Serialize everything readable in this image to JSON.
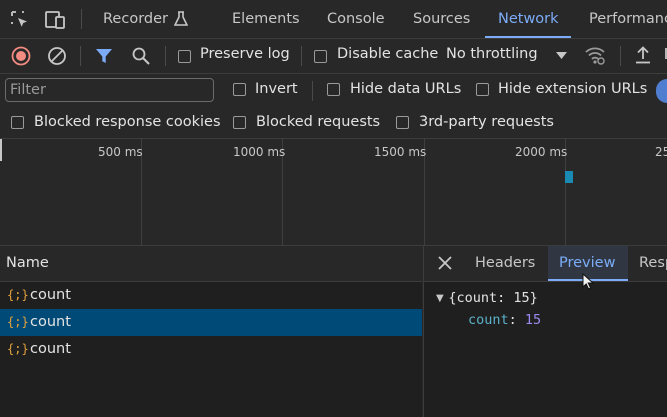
{
  "tabs": {
    "recorder": "Recorder",
    "elements": "Elements",
    "console": "Console",
    "sources": "Sources",
    "network": "Network",
    "performance": "Performanc"
  },
  "toolbar": {
    "preserve_log": "Preserve log",
    "disable_cache": "Disable cache",
    "throttling": "No throttling"
  },
  "filter": {
    "placeholder": "Filter",
    "invert": "Invert",
    "hide_data_urls": "Hide data URLs",
    "hide_extension_urls": "Hide extension URLs",
    "blocked_response_cookies": "Blocked response cookies",
    "blocked_requests": "Blocked requests",
    "third_party_requests": "3rd-party requests"
  },
  "timeline": {
    "ticks": [
      "500 ms",
      "1000 ms",
      "1500 ms",
      "2000 ms",
      "25"
    ]
  },
  "requests": {
    "header": "Name",
    "icon_glyph": "{;}",
    "rows": [
      {
        "name": "count",
        "selected": false
      },
      {
        "name": "count",
        "selected": true
      },
      {
        "name": "count",
        "selected": false
      }
    ]
  },
  "detail": {
    "tabs": {
      "headers": "Headers",
      "preview": "Preview",
      "response": "Resp"
    },
    "preview": {
      "summary": "{count: 15}",
      "key": "count",
      "value": "15"
    }
  },
  "colors": {
    "accent": "#7cacf8",
    "record": "#f28b82",
    "selected_row": "#004a77",
    "json_icon": "#e5a33e",
    "json_key": "#5cb1c9",
    "json_number": "#9a8bf0"
  }
}
